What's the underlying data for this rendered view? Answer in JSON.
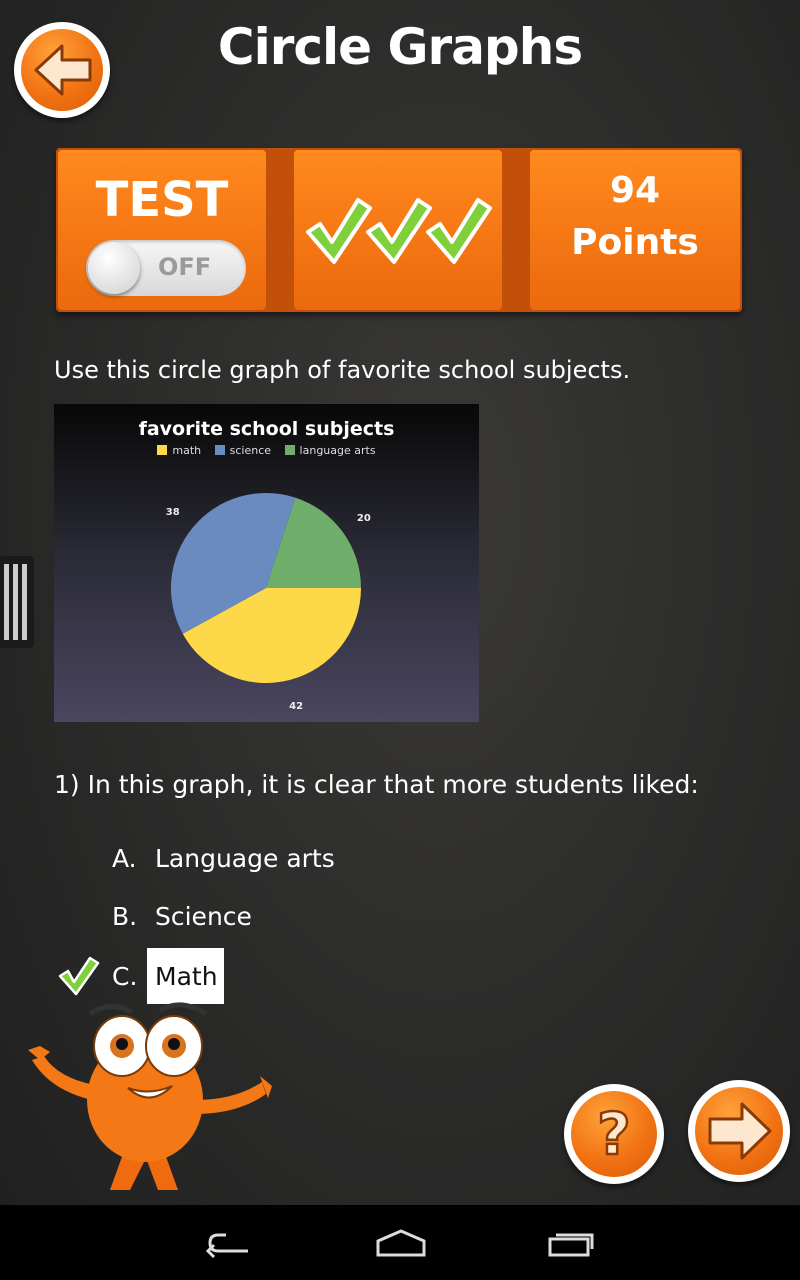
{
  "header": {
    "title": "Circle Graphs"
  },
  "test_panel": {
    "label": "TEST",
    "toggle_state": "OFF"
  },
  "progress": {
    "checkmarks": 3
  },
  "score": {
    "value": "94",
    "label": "Points"
  },
  "question": {
    "prompt": "Use this circle graph of favorite school subjects.",
    "text": "1) In this graph, it is clear that more students liked:",
    "options": [
      {
        "letter": "A.",
        "text": "Language arts"
      },
      {
        "letter": "B.",
        "text": "Science"
      },
      {
        "letter": "C.",
        "text": "Math"
      }
    ],
    "selected_index": 2
  },
  "colors": {
    "accent": "#f47513",
    "check": "#6fbf2e",
    "math": "#fdd94a",
    "science": "#6a8bc0",
    "language_arts": "#6fae6a"
  },
  "chart_data": {
    "type": "pie",
    "title": "favorite school subjects",
    "categories": [
      "math",
      "science",
      "language arts"
    ],
    "values": [
      42,
      38,
      20
    ],
    "colors": [
      "#fdd94a",
      "#6a8bc0",
      "#6fae6a"
    ],
    "legend_position": "top"
  }
}
